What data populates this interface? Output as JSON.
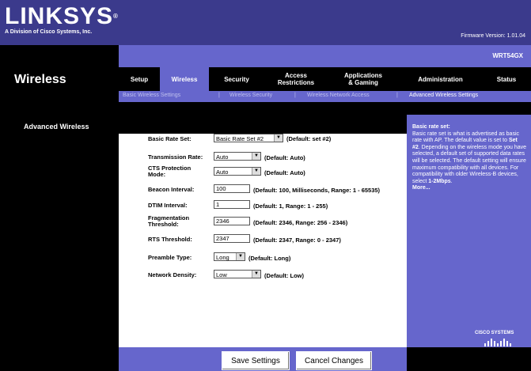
{
  "brand": {
    "name": "LINKSYS",
    "reg": "®",
    "tagline": "A Division of Cisco Systems, Inc."
  },
  "firmware": "Firmware Version: 1.01.04",
  "model": "WRT54GX",
  "section": "Wireless",
  "tabs": [
    "Setup",
    "Wireless",
    "Security",
    "Access\nRestrictions",
    "Applications\n& Gaming",
    "Administration",
    "Status"
  ],
  "subnav": [
    "Basic Wireless Settings",
    "|",
    "Wireless Security",
    "|",
    "Wireless Network Access",
    "|",
    "Advanced Wireless Settings"
  ],
  "left_label": "Advanced Wireless",
  "form": {
    "basic_rate": {
      "label": "Basic Rate Set:",
      "value": "Basic Rate Set #2",
      "default": "(Default: set #2)"
    },
    "tx_rate": {
      "label": "Transmission Rate:",
      "value": "Auto",
      "default": "(Default: Auto)"
    },
    "cts": {
      "label": "CTS Protection Mode:",
      "value": "Auto",
      "default": "(Default: Auto)"
    },
    "beacon": {
      "label": "Beacon Interval:",
      "value": "100",
      "default": "(Default: 100, Milliseconds, Range: 1 - 65535)"
    },
    "dtim": {
      "label": "DTIM Interval:",
      "value": "1",
      "default": "(Default: 1, Range: 1 - 255)"
    },
    "frag": {
      "label": "Fragmentation Threshold:",
      "value": "2346",
      "default": "(Default: 2346, Range: 256 - 2346)"
    },
    "rts": {
      "label": "RTS Threshold:",
      "value": "2347",
      "default": "(Default: 2347, Range: 0 - 2347)"
    },
    "preamble": {
      "label": "Preamble Type:",
      "value": "Long",
      "default": "(Default: Long)"
    },
    "density": {
      "label": "Network Density:",
      "value": "Low",
      "default": "(Default: Low)"
    }
  },
  "help": {
    "title": "Basic rate set:",
    "text1": "Basic rate set is what is advertised as basic rate with AP. The default value is set to",
    "bold1": "Set #2",
    "text2": ". Depending on the wireless mode you have selected, a default set of supported data rates will be selected. The default setting will ensure maximum compatibility with all devices. For compatibility with older Wireless-B devices, select",
    "bold2": "1-2Mbps",
    "more": "More..."
  },
  "cisco": "CISCO SYSTEMS",
  "buttons": {
    "save": "Save Settings",
    "cancel": "Cancel Changes"
  }
}
